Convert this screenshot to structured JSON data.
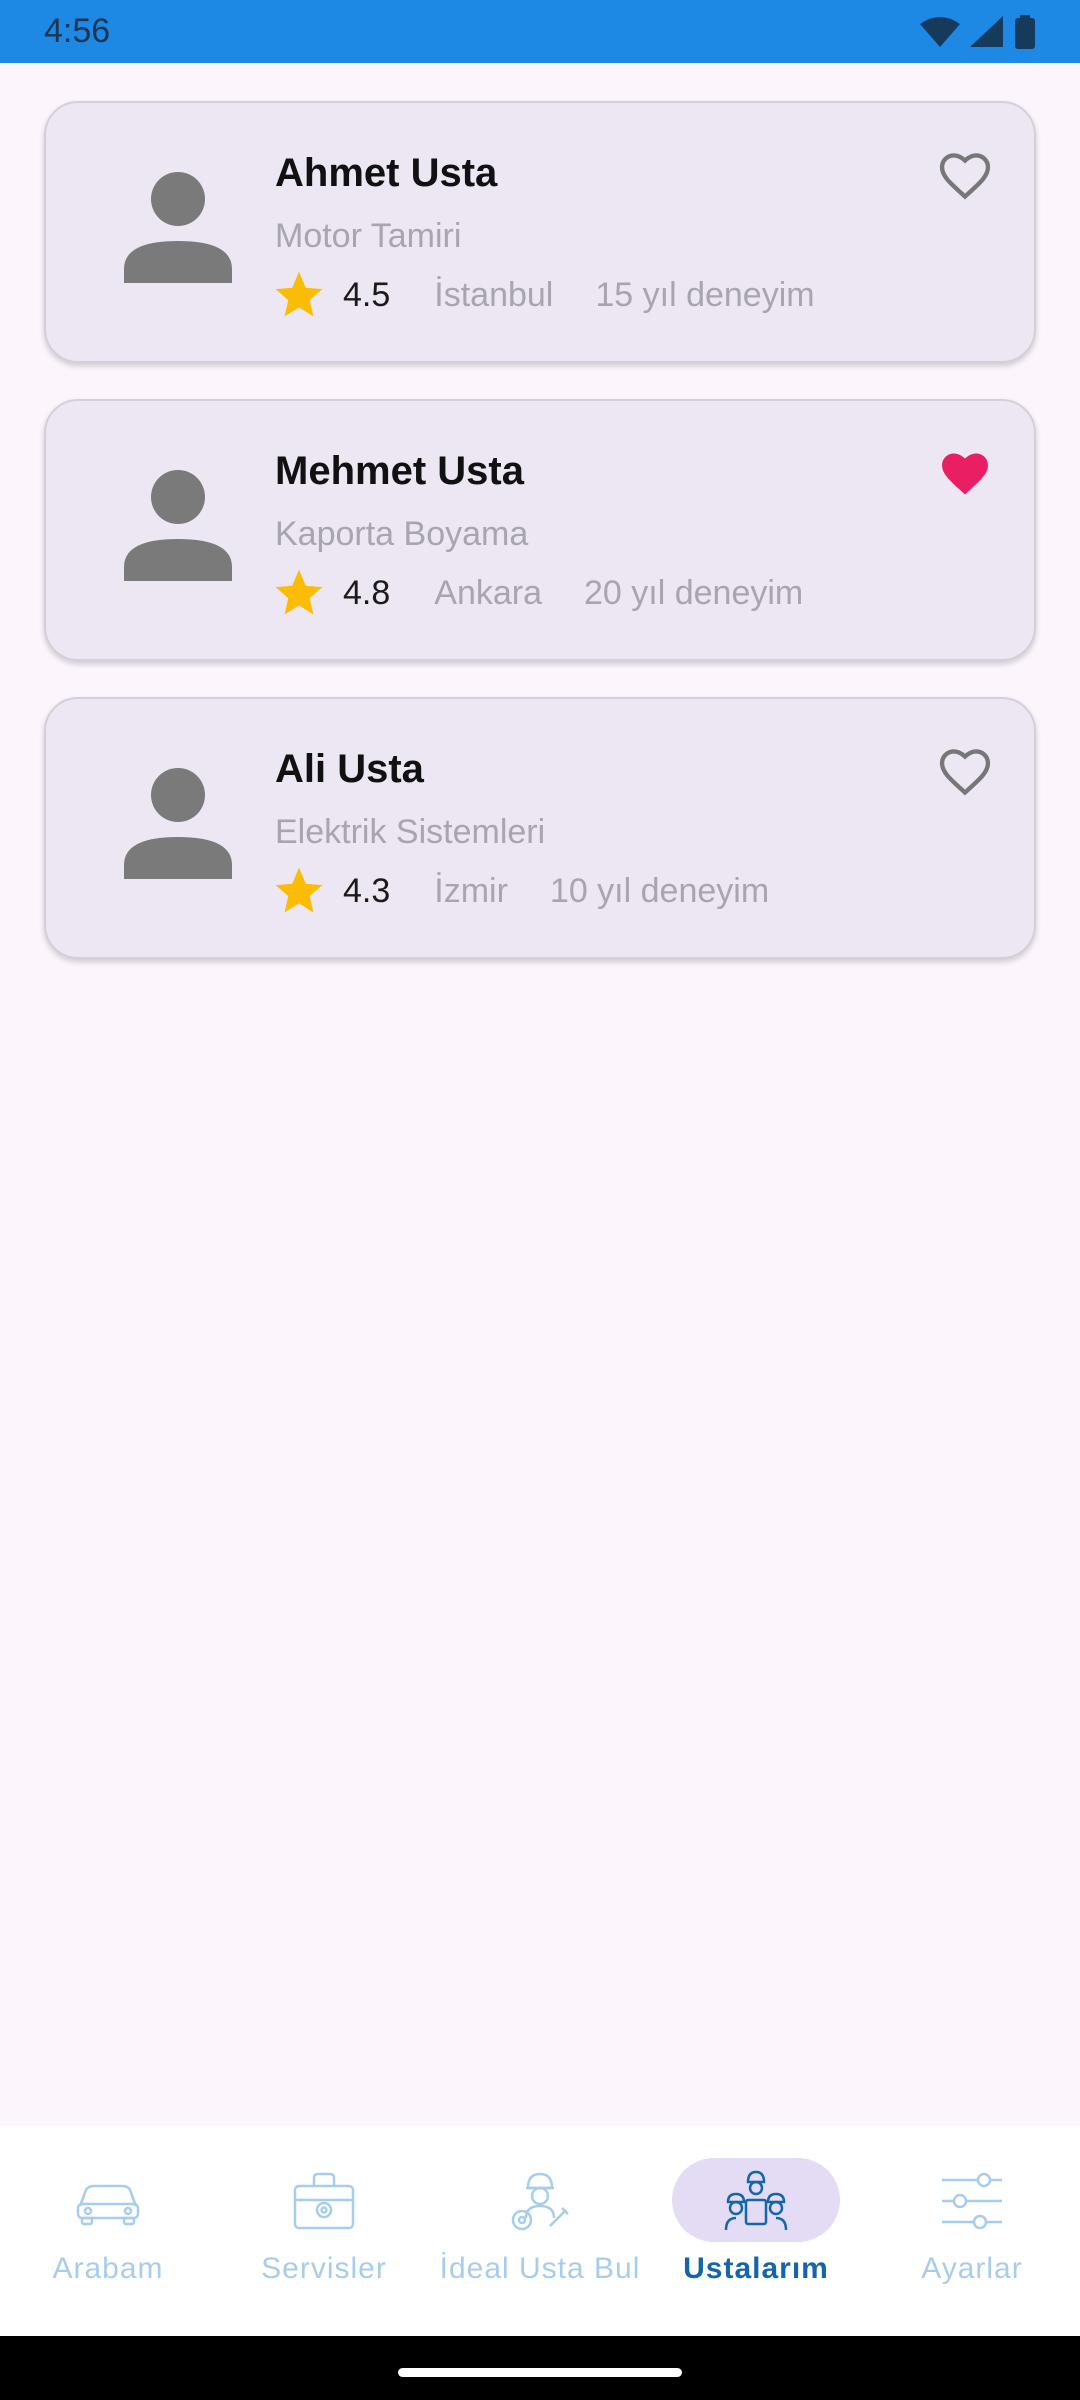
{
  "status_bar": {
    "time": "4:56",
    "icons": [
      "wifi-icon",
      "cellular-signal-icon",
      "battery-icon"
    ]
  },
  "mechanics": [
    {
      "name": "Ahmet Usta",
      "specialty": "Motor Tamiri",
      "rating": "4.5",
      "city": "İstanbul",
      "experience": "15 yıl deneyim",
      "favorite": false
    },
    {
      "name": "Mehmet Usta",
      "specialty": "Kaporta Boyama",
      "rating": "4.8",
      "city": "Ankara",
      "experience": "20 yıl deneyim",
      "favorite": true
    },
    {
      "name": "Ali Usta",
      "specialty": "Elektrik Sistemleri",
      "rating": "4.3",
      "city": "İzmir",
      "experience": "10 yıl deneyim",
      "favorite": false
    }
  ],
  "bottom_nav": {
    "items": [
      {
        "label": "Arabam",
        "icon": "car-icon",
        "active": false
      },
      {
        "label": "Servisler",
        "icon": "toolbox-icon",
        "active": false
      },
      {
        "label": "İdeal Usta Bul",
        "icon": "mechanic-icon",
        "active": false
      },
      {
        "label": "Ustalarım",
        "icon": "workers-icon",
        "active": true
      },
      {
        "label": "Ayarlar",
        "icon": "sliders-icon",
        "active": false
      }
    ]
  },
  "colors": {
    "status_bar": "#1e88e5",
    "background": "#fcf6fc",
    "card": "#ede6f3",
    "star": "#fbbc05",
    "favorite": "#e91e63",
    "nav_active": "#1565a8",
    "nav_inactive": "#a8cde9",
    "nav_pill": "#e4dcf4"
  }
}
